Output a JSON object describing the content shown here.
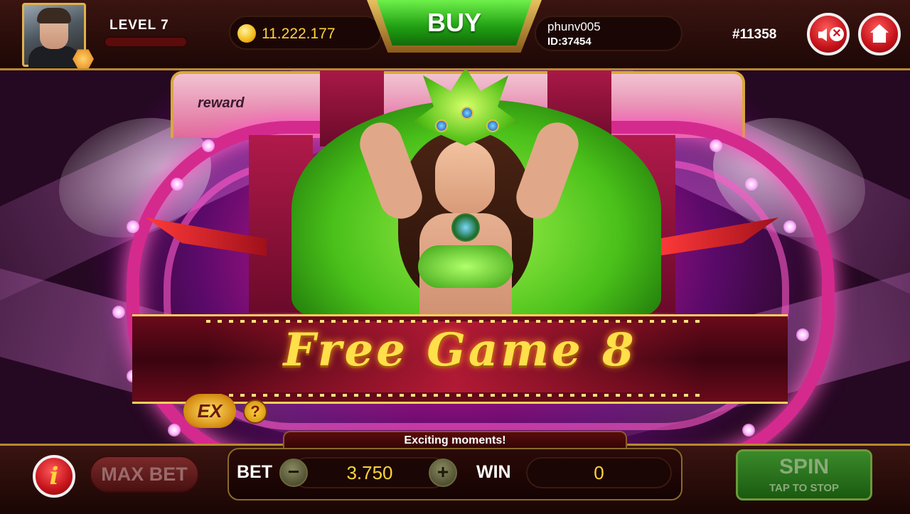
{
  "player": {
    "level": "LEVEL  7",
    "coins": "11.222.177",
    "username": "phunv005",
    "user_id": "ID:37454",
    "room_id": "#11358"
  },
  "header": {
    "buy_label": "BUY"
  },
  "icons": {
    "avatar": "player-avatar",
    "rank": "hexagon-rank-badge",
    "coin": "gold-coin-icon",
    "sound": "speaker-mute-icon",
    "home": "home-icon",
    "info": "info-icon"
  },
  "stage": {
    "reward_label": "reward",
    "banner_text": "Free Game 8",
    "ex_label": "EX",
    "ex_help": "?"
  },
  "footer": {
    "exciting_text": "Exciting moments!",
    "info_label": "i",
    "max_bet_label": "MAX BET",
    "bet_label": "BET",
    "bet_value": "3.750",
    "minus_label": "−",
    "plus_label": "+",
    "win_label": "WIN",
    "win_value": "0",
    "spin_label": "SPIN",
    "spin_sub": "TAP TO STOP"
  },
  "colors": {
    "accent_gold": "#ffd23a",
    "buy_green": "#1f9e12",
    "stage_pink": "#d42a8e"
  }
}
